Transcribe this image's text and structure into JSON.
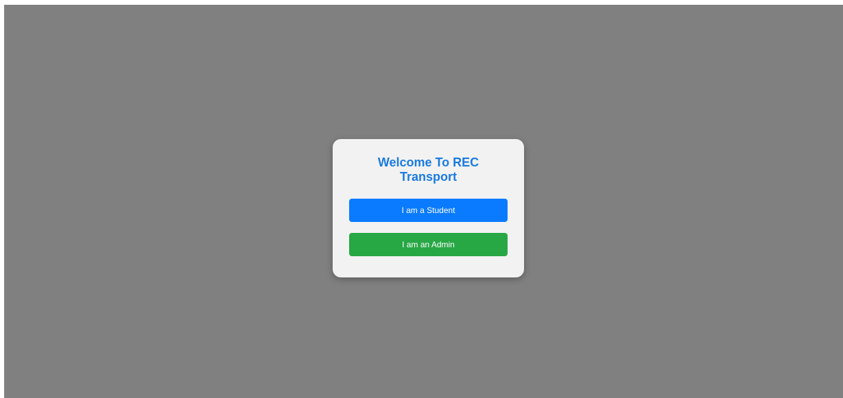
{
  "welcome": {
    "title_line1": "Welcome To REC",
    "title_line2": "Transport"
  },
  "buttons": {
    "student_label": "I am a Student",
    "admin_label": "I am an Admin"
  },
  "colors": {
    "background": "#808080",
    "card": "#f2f2f2",
    "title": "#1a7be0",
    "student_button": "#0a7bff",
    "admin_button": "#28a745"
  }
}
